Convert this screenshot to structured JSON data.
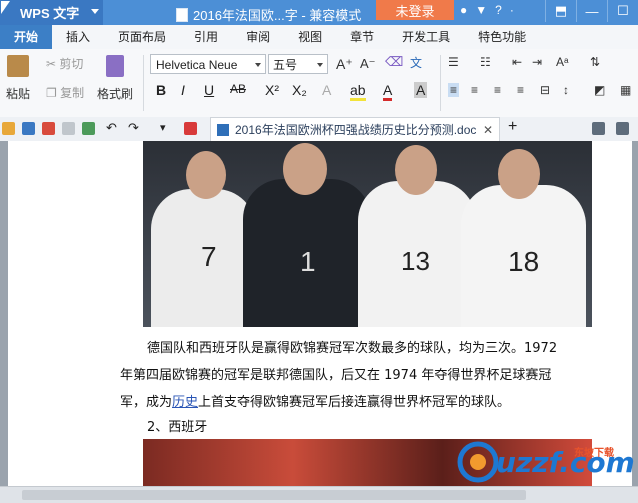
{
  "titlebar": {
    "app_name": "WPS 文字",
    "doc_title": "2016年法国欧...字 - 兼容模式",
    "login_label": "未登录"
  },
  "tabs": [
    "开始",
    "插入",
    "页面布局",
    "引用",
    "审阅",
    "视图",
    "章节",
    "开发工具",
    "特色功能"
  ],
  "ribbon": {
    "paste": "粘贴",
    "cut": "剪切",
    "copy": "复制",
    "format_painter": "格式刷",
    "font_name": "Helvetica Neue",
    "font_size": "五号"
  },
  "document_tab": "2016年法国欧洲杯四强战绩历史比分预测.doc",
  "content": {
    "para1_a": "德国队和西班牙队是赢得欧锦赛冠军次数最多的球队，均为三次。1972",
    "para1_b": "年第四届欧锦赛的冠军是联邦德国队，后又在 1974 年夺得世界杯足球赛冠",
    "para1_c_pre": "军，成为",
    "para1_c_link": "历史",
    "para1_c_post": "上首支夺得欧锦赛冠军后接连赢得世界杯冠军的球队。",
    "heading2": "2、西班牙",
    "jersey_numbers": [
      "7",
      "1",
      "13",
      "18"
    ]
  },
  "watermark": {
    "text": "uzzf.com",
    "sub": "东坡下载"
  },
  "colors": {
    "titlebar": "#4c8fd6",
    "tab_active": "#3c7fc6",
    "login": "#f07a4a"
  }
}
